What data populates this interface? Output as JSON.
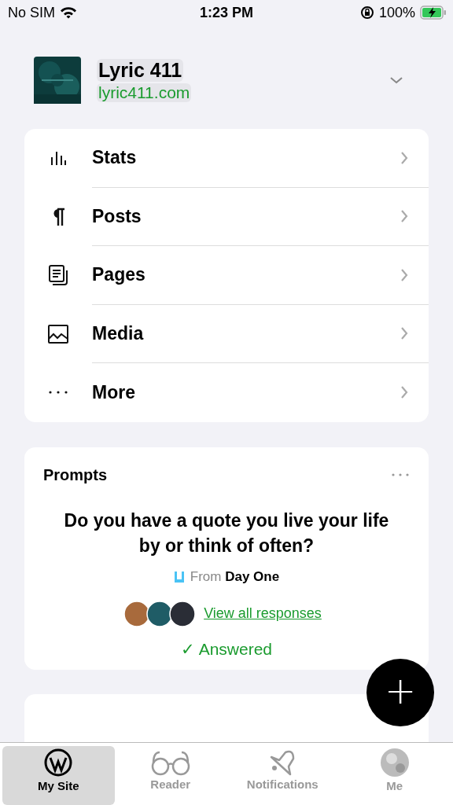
{
  "status_bar": {
    "carrier": "No SIM",
    "time": "1:23 PM",
    "battery": "100%"
  },
  "site": {
    "name": "Lyric 411",
    "url": "lyric411.com"
  },
  "menu": [
    {
      "label": "Stats"
    },
    {
      "label": "Posts"
    },
    {
      "label": "Pages"
    },
    {
      "label": "Media"
    },
    {
      "label": "More"
    }
  ],
  "prompts": {
    "title": "Prompts",
    "question": "Do you have a quote you live your life by or think of often?",
    "from_label": "From",
    "from_source": "Day One",
    "link": "View all responses",
    "answered": true,
    "answered_label": "✓ Answered"
  },
  "fab": {
    "label": "+"
  },
  "tabs": [
    {
      "label": "My Site",
      "selected": true
    },
    {
      "label": "Reader",
      "selected": false
    },
    {
      "label": "Notifications",
      "selected": false
    },
    {
      "label": "Me",
      "selected": false
    }
  ]
}
